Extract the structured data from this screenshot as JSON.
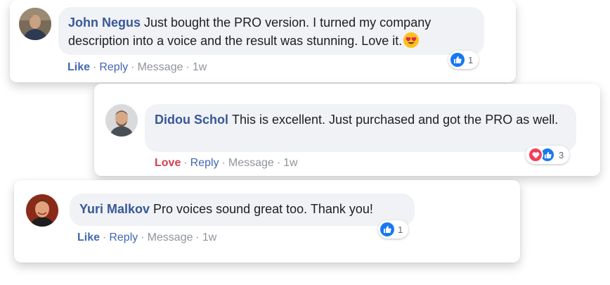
{
  "comments": [
    {
      "name": "John Negus",
      "text": "Just bought the PRO version. I turned my company description into a voice and the result was stunning. Love it.",
      "emoji": "heart-eyes-emoji",
      "actions": {
        "reaction": "Like",
        "reply": "Reply",
        "message": "Message",
        "time": "1w",
        "sep": "·"
      },
      "reactions": {
        "types": [
          "like-icon"
        ],
        "count": "1"
      }
    },
    {
      "name": "Didou Schol",
      "text": "This is excellent. Just purchased and got the PRO as well.",
      "actions": {
        "reaction": "Love",
        "reply": "Reply",
        "message": "Message",
        "time": "1w",
        "sep": "·"
      },
      "reactions": {
        "types": [
          "heart-icon",
          "like-icon"
        ],
        "count": "3"
      }
    },
    {
      "name": "Yuri Malkov",
      "text": "Pro voices sound great too. Thank you!",
      "actions": {
        "reaction": "Like",
        "reply": "Reply",
        "message": "Message",
        "time": "1w",
        "sep": "·"
      },
      "reactions": {
        "types": [
          "like-icon"
        ],
        "count": "1"
      }
    }
  ],
  "colors": {
    "name": "#385898",
    "like": "#4267b2",
    "love": "#d0414d",
    "meta": "#90949c",
    "bubble": "#f0f2f5"
  }
}
